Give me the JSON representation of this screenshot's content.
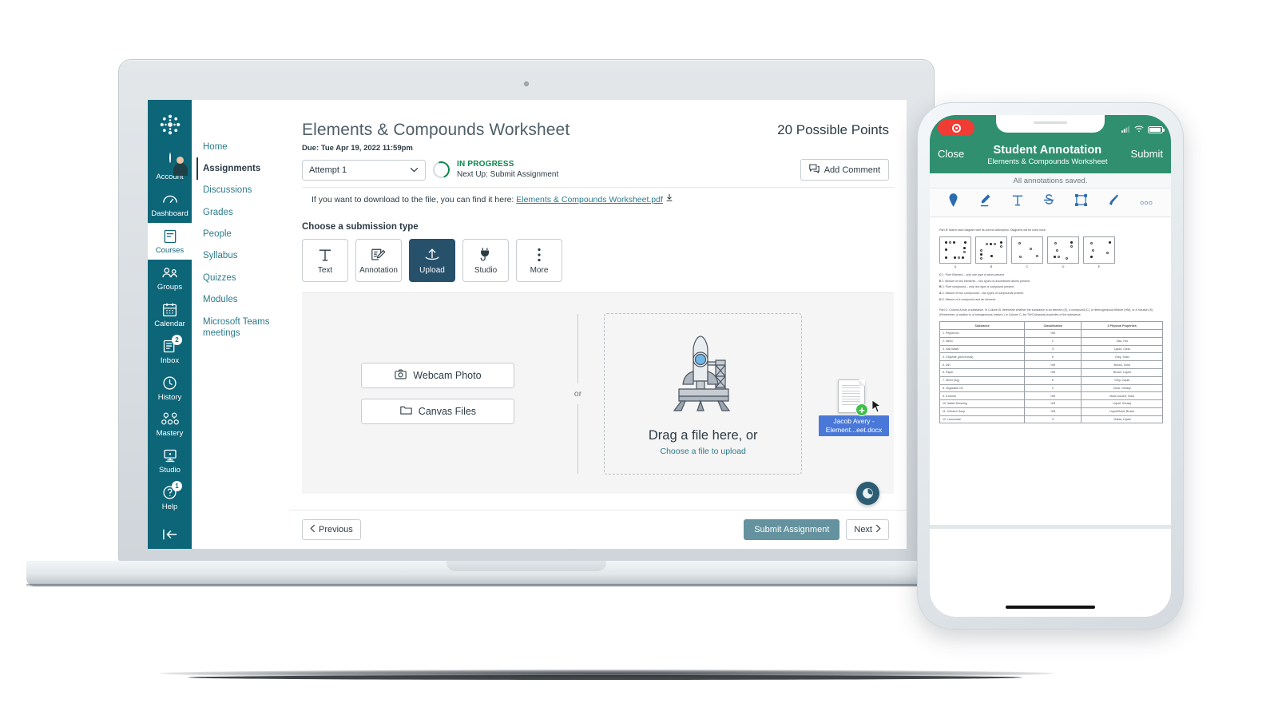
{
  "laptop": {
    "global_nav": {
      "logo": "canvas-logo",
      "items": [
        {
          "label": "Account",
          "icon": "avatar-icon",
          "badge": null,
          "active": false
        },
        {
          "label": "Dashboard",
          "icon": "dashboard-icon",
          "badge": null,
          "active": false
        },
        {
          "label": "Courses",
          "icon": "courses-icon",
          "badge": null,
          "active": true
        },
        {
          "label": "Groups",
          "icon": "groups-icon",
          "badge": null,
          "active": false
        },
        {
          "label": "Calendar",
          "icon": "calendar-icon",
          "badge": null,
          "active": false
        },
        {
          "label": "Inbox",
          "icon": "inbox-icon",
          "badge": "2",
          "active": false
        },
        {
          "label": "History",
          "icon": "clock-icon",
          "badge": null,
          "active": false
        },
        {
          "label": "Mastery",
          "icon": "mastery-icon",
          "badge": null,
          "active": false
        },
        {
          "label": "Studio",
          "icon": "studio-icon",
          "badge": null,
          "active": false
        },
        {
          "label": "Help",
          "icon": "question-icon",
          "badge": "1",
          "active": false
        }
      ],
      "collapse_icon": "collapse-left-icon"
    },
    "course_nav": {
      "items": [
        {
          "label": "Home",
          "active": false
        },
        {
          "label": "Assignments",
          "active": true
        },
        {
          "label": "Discussions",
          "active": false
        },
        {
          "label": "Grades",
          "active": false
        },
        {
          "label": "People",
          "active": false
        },
        {
          "label": "Syllabus",
          "active": false
        },
        {
          "label": "Quizzes",
          "active": false
        },
        {
          "label": "Modules",
          "active": false
        },
        {
          "label": "Microsoft Teams meetings",
          "active": false
        }
      ]
    },
    "assignment": {
      "title": "Elements & Compounds Worksheet",
      "possible_points": "20 Possible Points",
      "due": "Due: Tue Apr 19, 2022 11:59pm",
      "attempt_value": "Attempt 1",
      "status_label": "IN PROGRESS",
      "status_next": "Next Up: Submit Assignment",
      "add_comment_label": "Add Comment",
      "download_text": "If you want to download to the file, you can find it here:",
      "download_link": "Elements & Compounds Worksheet.pdf"
    },
    "submission": {
      "section_label": "Choose a submission type",
      "types": [
        {
          "label": "Text",
          "icon": "text-t-icon",
          "selected": false
        },
        {
          "label": "Annotation",
          "icon": "annotation-pencil-icon",
          "selected": false
        },
        {
          "label": "Upload",
          "icon": "upload-arrow-icon",
          "selected": true
        },
        {
          "label": "Studio",
          "icon": "plug-icon",
          "selected": false
        },
        {
          "label": "More",
          "icon": "kebab-menu-icon",
          "selected": false
        }
      ],
      "webcam_label": "Webcam Photo",
      "canvas_files_label": "Canvas Files",
      "or_label": "or",
      "dropzone_title": "Drag a file here, or",
      "dropzone_sub": "Choose a file to upload",
      "drag_ghost_label": "Jacob Avery - Element...eet.docx"
    },
    "footer": {
      "previous_label": "Previous",
      "submit_label": "Submit Assignment",
      "next_label": "Next"
    },
    "colors": {
      "brand_teal": "#0d6578",
      "link_teal": "#2b7b8c",
      "selected_navy": "#27506b",
      "in_progress_green": "#0b874b",
      "submit_button": "#64929e"
    }
  },
  "phone": {
    "status": {
      "recording": "record-badge",
      "wifi": "wifi-icon",
      "battery": "battery-icon",
      "signal": "signal-icon"
    },
    "navbar": {
      "close_label": "Close",
      "title": "Student Annotation",
      "subtitle": "Elements & Compounds Worksheet",
      "submit_label": "Submit"
    },
    "saved_text": "All annotations saved.",
    "tools": [
      {
        "name": "pin-icon"
      },
      {
        "name": "highlighter-icon"
      },
      {
        "name": "text-t-icon"
      },
      {
        "name": "strikethrough-icon"
      },
      {
        "name": "square-select-icon"
      },
      {
        "name": "brush-icon"
      },
      {
        "name": "more-dots-icon"
      }
    ],
    "document": {
      "part_b_heading": "Part B: Match each diagram with its correct description.  Diagrams will be used once.",
      "diagram_labels": [
        "A",
        "B",
        "C",
        "D",
        "E"
      ],
      "match_items": [
        {
          "answer": "C",
          "text": "1. Pure Element – only one type of atom present."
        },
        {
          "answer": "E",
          "text": "2. Mixture of two elements – two types of uncombined atoms present."
        },
        {
          "answer": "B",
          "text": "3. Pure compound – only one type of compound present."
        },
        {
          "answer": "A",
          "text": "4. Mixture of two compounds – two types of compounds present."
        },
        {
          "answer": "D",
          "text": "5. Mixture of a compound and an element."
        }
      ],
      "part_c_heading": "Part C: Column A lists a substance.  In Column B, determine whether the substance is an element (E), a compound (C), a Heterogeneous Mixture (HM), or a Solution (S).  (Remember: a solution is a homogeneous mixture.)  In Column C, list TWO physical properties of the substance.",
      "table_headers": [
        "Substance",
        "Classification",
        "2 Physical Properties"
      ],
      "table_rows": [
        [
          "1. Pepperoni",
          "HM",
          ""
        ],
        [
          "2. Neon",
          "C",
          "Gas, Hot"
        ],
        [
          "3. Salt Water",
          "S",
          "Liquid, Clear"
        ],
        [
          "4. Graphite (pencil lead)",
          "E",
          "Grey, Solid"
        ],
        [
          "5. Dirt",
          "HM",
          "Brown, Solid"
        ],
        [
          "6. Paper",
          "HM",
          "Brown, Liquid"
        ],
        [
          "7. Silver (Ag)",
          "E",
          "Grey, Liquid"
        ],
        [
          "8. Vegetable Oil",
          "C",
          "Clear, Greasy"
        ],
        [
          "9. A burrito",
          "HM",
          "Multi-colored, Solid"
        ],
        [
          "10. Italian Dressing",
          "HM",
          "Liquid, Greasy"
        ],
        [
          "11. Chicken Soup",
          "HM",
          "Liquid/Solid, Brown"
        ],
        [
          "12. Lemonade",
          "S",
          "Yellow, Liquid"
        ]
      ]
    },
    "colors": {
      "nav_green": "#2f8f6f",
      "tool_blue": "#2b6cb0",
      "record_red": "#f03c34"
    }
  }
}
